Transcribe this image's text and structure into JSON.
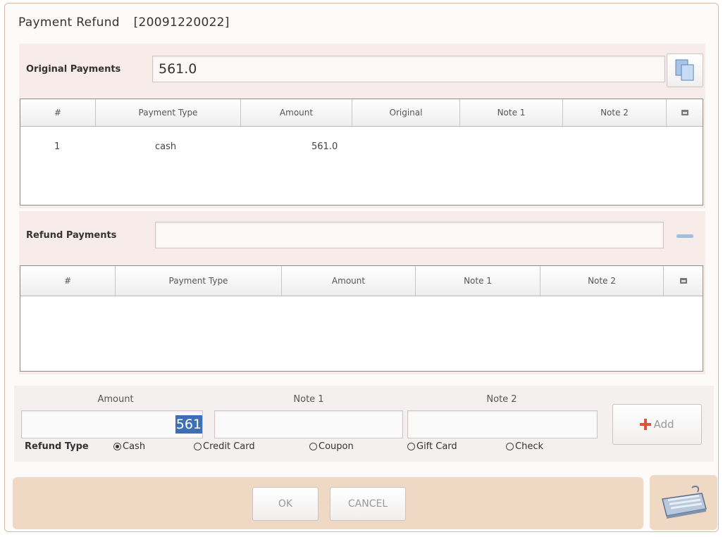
{
  "window": {
    "title": "Payment Refund",
    "order_id": "[20091220022]"
  },
  "original": {
    "label": "Original Payments",
    "total": "561.0",
    "copy_icon": "copy-documents-icon",
    "columns": [
      "#",
      "Payment Type",
      "Amount",
      "Original",
      "Note 1",
      "Note 2"
    ],
    "rows": [
      {
        "num": "1",
        "type": "cash",
        "amount": "561.0",
        "original": "",
        "note1": "",
        "note2": ""
      }
    ]
  },
  "refund": {
    "label": "Refund Payments",
    "value": "",
    "remove_icon": "minus-icon",
    "columns": [
      "#",
      "Payment Type",
      "Amount",
      "Note 1",
      "Note 2"
    ],
    "rows": []
  },
  "entry": {
    "amount_label": "Amount",
    "amount_value": "561",
    "note1_label": "Note 1",
    "note1_value": "",
    "note2_label": "Note 2",
    "note2_value": "",
    "add_label": "Add",
    "refund_type_label": "Refund Type",
    "refund_types": [
      "Cash",
      "Credit Card",
      "Coupon",
      "Gift Card",
      "Check"
    ],
    "selected_refund_type": "Cash"
  },
  "footer": {
    "ok_label": "OK",
    "cancel_label": "CANCEL",
    "keyboard_icon": "keyboard-icon"
  },
  "colors": {
    "footer_bar": "#f0d9c4",
    "panel": "#f7ecea",
    "add_plus": "#e0523a",
    "selection": "#3d6fb6"
  }
}
